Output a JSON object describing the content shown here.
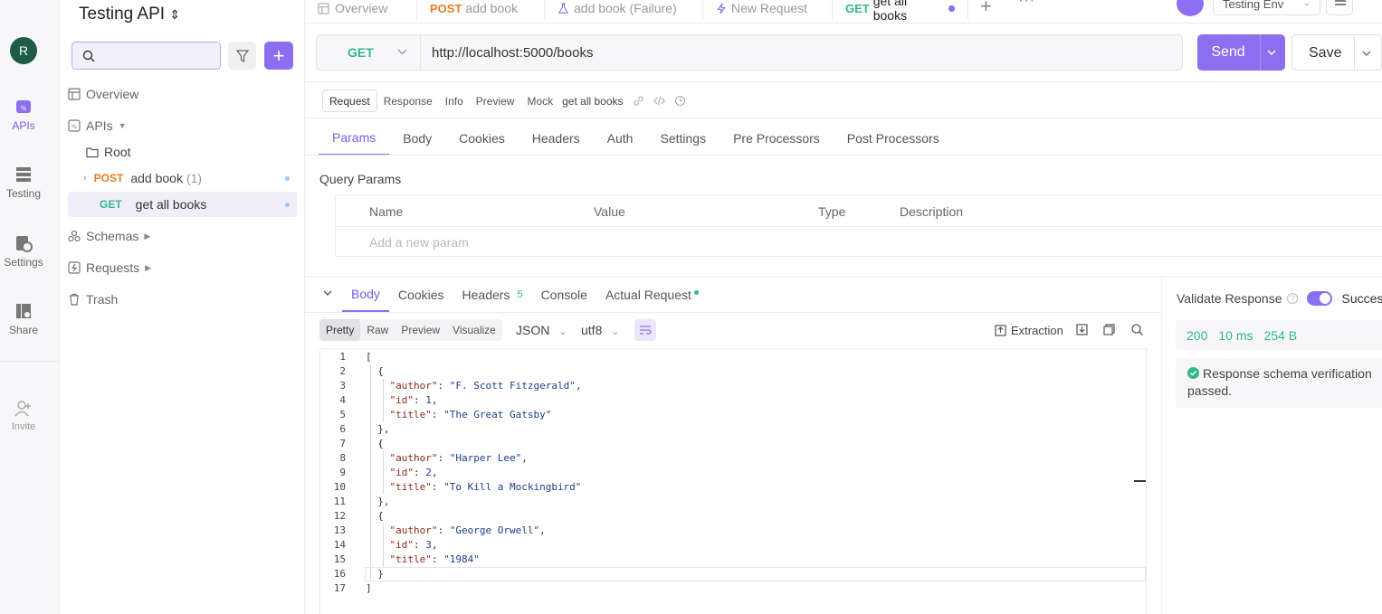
{
  "rail": {
    "avatar_initial": "R",
    "items": [
      {
        "label": "APIs",
        "icon": "apis-icon"
      },
      {
        "label": "Testing",
        "icon": "testing-icon"
      },
      {
        "label": "Settings",
        "icon": "settings-icon"
      },
      {
        "label": "Share",
        "icon": "share-icon"
      }
    ],
    "invite_label": "Invite"
  },
  "sidebar": {
    "project_title": "Testing API",
    "search_placeholder": "",
    "tree": {
      "overview": "Overview",
      "apis": "APIs",
      "root": "Root",
      "post_method": "POST",
      "post_name": "add book",
      "post_count": "(1)",
      "get_method": "GET",
      "get_name": "get all books",
      "schemas": "Schemas",
      "requests": "Requests",
      "trash": "Trash"
    }
  },
  "tabs": {
    "t1": "Overview",
    "t2_method": "POST",
    "t2_name": "add book",
    "t3": "add book (Failure)",
    "t4": "New Request",
    "t5_method": "GET",
    "t5_name": "get all books",
    "env": "Testing Env"
  },
  "request": {
    "method": "GET",
    "url": "http://localhost:5000/books",
    "send_label": "Send",
    "save_label": "Save",
    "modes": [
      "Request",
      "Response",
      "Info",
      "Preview",
      "Mock"
    ],
    "name": "get all books",
    "tabs": [
      "Params",
      "Body",
      "Cookies",
      "Headers",
      "Auth",
      "Settings",
      "Pre Processors",
      "Post Processors"
    ],
    "query_params_title": "Query Params",
    "columns": [
      "Name",
      "Value",
      "Type",
      "Description"
    ],
    "add_param_placeholder": "Add a new param"
  },
  "response": {
    "tabs": {
      "body": "Body",
      "cookies": "Cookies",
      "headers": "Headers",
      "headers_count": "5",
      "console": "Console",
      "actual": "Actual Request"
    },
    "formats": [
      "Pretty",
      "Raw",
      "Preview",
      "Visualize"
    ],
    "lang": "JSON",
    "encoding": "utf8",
    "extraction_label": "Extraction",
    "code_lines": [
      "[",
      "  {",
      "    \"author\": \"F. Scott Fitzgerald\",",
      "    \"id\": 1,",
      "    \"title\": \"The Great Gatsby\"",
      "  },",
      "  {",
      "    \"author\": \"Harper Lee\",",
      "    \"id\": 2,",
      "    \"title\": \"To Kill a Mockingbird\"",
      "  },",
      "  {",
      "    \"author\": \"George Orwell\",",
      "    \"id\": 3,",
      "    \"title\": \"1984\"",
      "  }",
      "]"
    ],
    "validate_label": "Validate Response",
    "success_label": "Succes",
    "status": "200",
    "time": "10 ms",
    "size": "254 B",
    "verify_text": "Response schema verification passed."
  },
  "colors": {
    "accent": "#8c6ff0",
    "get": "#2fb88a",
    "post": "#e67e22"
  }
}
